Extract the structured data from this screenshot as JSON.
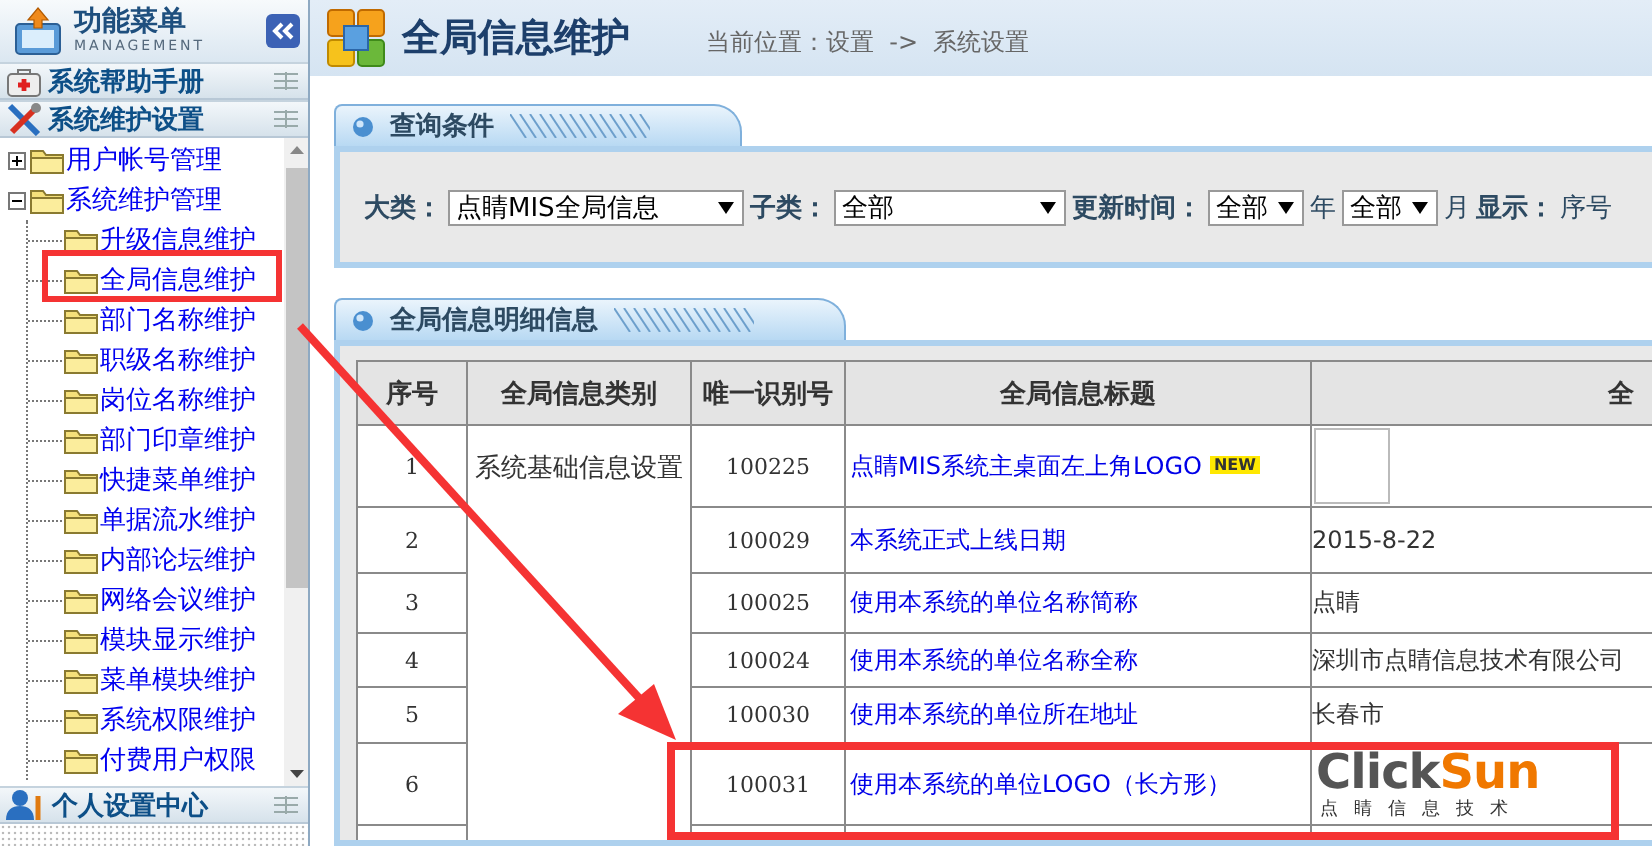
{
  "sidebar": {
    "title": "功能菜单",
    "subtitle": "MANAGEMENT",
    "sections": [
      {
        "kind": "help",
        "label": "系统帮助手册"
      },
      {
        "kind": "tools",
        "label": "系统维护设置",
        "tree": [
          {
            "label": "用户帐号管理",
            "expanded": false
          },
          {
            "label": "系统维护管理",
            "expanded": true,
            "children": [
              {
                "label": "升级信息维护"
              },
              {
                "label": "全局信息维护"
              },
              {
                "label": "部门名称维护"
              },
              {
                "label": "职级名称维护"
              },
              {
                "label": "岗位名称维护"
              },
              {
                "label": "部门印章维护"
              },
              {
                "label": "快捷菜单维护"
              },
              {
                "label": "单据流水维护"
              },
              {
                "label": "内部论坛维护"
              },
              {
                "label": "网络会议维护"
              },
              {
                "label": "模块显示维护"
              },
              {
                "label": "菜单模块维护"
              },
              {
                "label": "系统权限维护"
              },
              {
                "label": "付费用户权限"
              }
            ]
          }
        ]
      },
      {
        "kind": "user",
        "label": "个人设置中心"
      }
    ]
  },
  "header": {
    "title": "全局信息维护",
    "breadcrumb": "当前位置：设置  ->  系统设置"
  },
  "query": {
    "title": "查询条件",
    "filters": [
      {
        "kind": "label",
        "text": "大类："
      },
      {
        "kind": "select",
        "value": "点睛MIS全局信息"
      },
      {
        "kind": "label",
        "text": "子类："
      },
      {
        "kind": "select",
        "value": "全部"
      },
      {
        "kind": "label",
        "text": "更新时间："
      },
      {
        "kind": "select",
        "value": "全部"
      },
      {
        "kind": "unit",
        "text": "年"
      },
      {
        "kind": "select",
        "value": "全部"
      },
      {
        "kind": "unit",
        "text": "月"
      },
      {
        "kind": "label",
        "text": "显示："
      },
      {
        "kind": "unit",
        "text": "序号"
      }
    ]
  },
  "detail": {
    "title": "全局信息明细信息",
    "columns": [
      "序号",
      "全局信息类别",
      "唯一识别号",
      "全局信息标题",
      "全"
    ],
    "category": "系统基础信息设置",
    "rows": [
      {
        "index": "1",
        "id": "100225",
        "title": "点睛MIS系统主桌面左上角LOGO",
        "badge": "NEW",
        "kind": "image-box"
      },
      {
        "index": "2",
        "id": "100029",
        "title": "本系统正式上线日期",
        "kind": "text",
        "value": "2015-8-22"
      },
      {
        "index": "3",
        "id": "100025",
        "title": "使用本系统的单位名称简称",
        "kind": "text",
        "value": "点睛"
      },
      {
        "index": "4",
        "id": "100024",
        "title": "使用本系统的单位名称全称",
        "kind": "text",
        "value": "深圳市点睛信息技术有限公司"
      },
      {
        "index": "5",
        "id": "100030",
        "title": "使用本系统的单位所在地址",
        "kind": "text",
        "value": "长春市"
      },
      {
        "index": "6",
        "id": "100031",
        "title": "使用本系统的单位LOGO（长方形）",
        "kind": "logo",
        "logo_words": [
          "Click",
          "Sun"
        ],
        "logo_tagline": "点睛信息技术"
      }
    ]
  }
}
